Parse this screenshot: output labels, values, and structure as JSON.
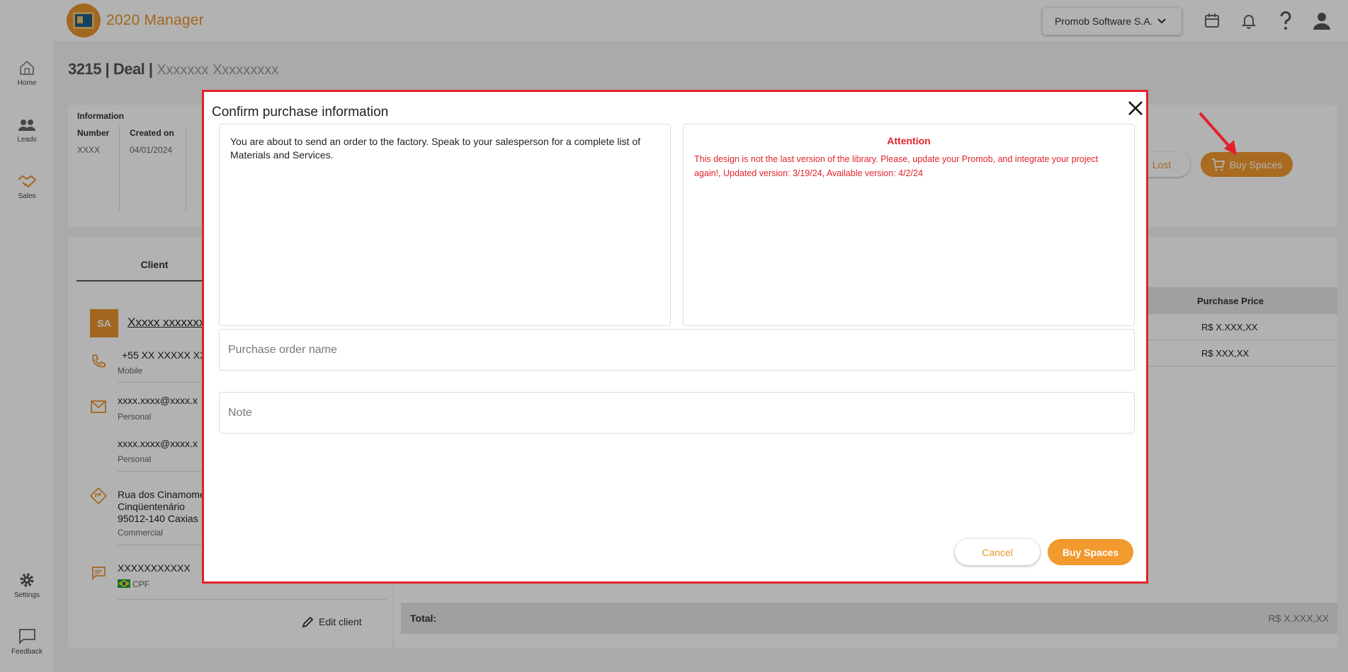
{
  "app": {
    "logo_text": "2020 Manager",
    "company": "Promob Software S.A."
  },
  "nav": {
    "home": "Home",
    "leads": "Leads",
    "sales": "Sales",
    "settings": "Settings",
    "feedback": "Feedback"
  },
  "deal": {
    "title": "3215 | Deal |",
    "subtitle": "Xxxxxxx Xxxxxxxxx"
  },
  "info": {
    "section": "Information",
    "number_label": "Number",
    "number_value": "XXXX",
    "created_label": "Created on",
    "created_value": "04/01/2024"
  },
  "actions": {
    "lost": "Lost",
    "buy_spaces": "Buy Spaces"
  },
  "client": {
    "tab": "Client",
    "avatar": "SA",
    "name": "Xxxxx xxxxxxx",
    "phone": "+55 XX XXXXX XXXX",
    "phone_type": "Mobile",
    "email1": "xxxx.xxxx@xxxx.x",
    "email1_type": "Personal",
    "email2": "xxxx.xxxx@xxxx.x",
    "email2_type": "Personal",
    "address_line1": "Rua dos Cinamome",
    "address_line2": "Cinqüentenário",
    "address_line3": "95012-140 Caxias",
    "address_type": "Commercial",
    "doc": "XXXXXXXXXXX",
    "doc_type": "CPF",
    "edit": "Edit client"
  },
  "items": {
    "col_price": "Purchase Price",
    "rows": [
      {
        "price": "R$ X.XXX,XX"
      },
      {
        "price": "R$ XXX,XX"
      }
    ],
    "total_label": "Total:",
    "total_value": "R$ X.XXX,XX"
  },
  "modal": {
    "title": "Confirm purchase information",
    "message": "You are about to send an order to the factory. Speak to your salesperson for a complete list of Materials and Services.",
    "attention_title": "Attention",
    "attention_text": "This design is not the last version of the library. Please, update your Promob, and integrate your project again!, Updated version: 3/19/24, Available version: 4/2/24",
    "order_placeholder": "Purchase order name",
    "note_placeholder": "Note",
    "cancel": "Cancel",
    "buy": "Buy Spaces"
  },
  "colors": {
    "accent": "#f29a2e",
    "alert": "#e2222a"
  }
}
